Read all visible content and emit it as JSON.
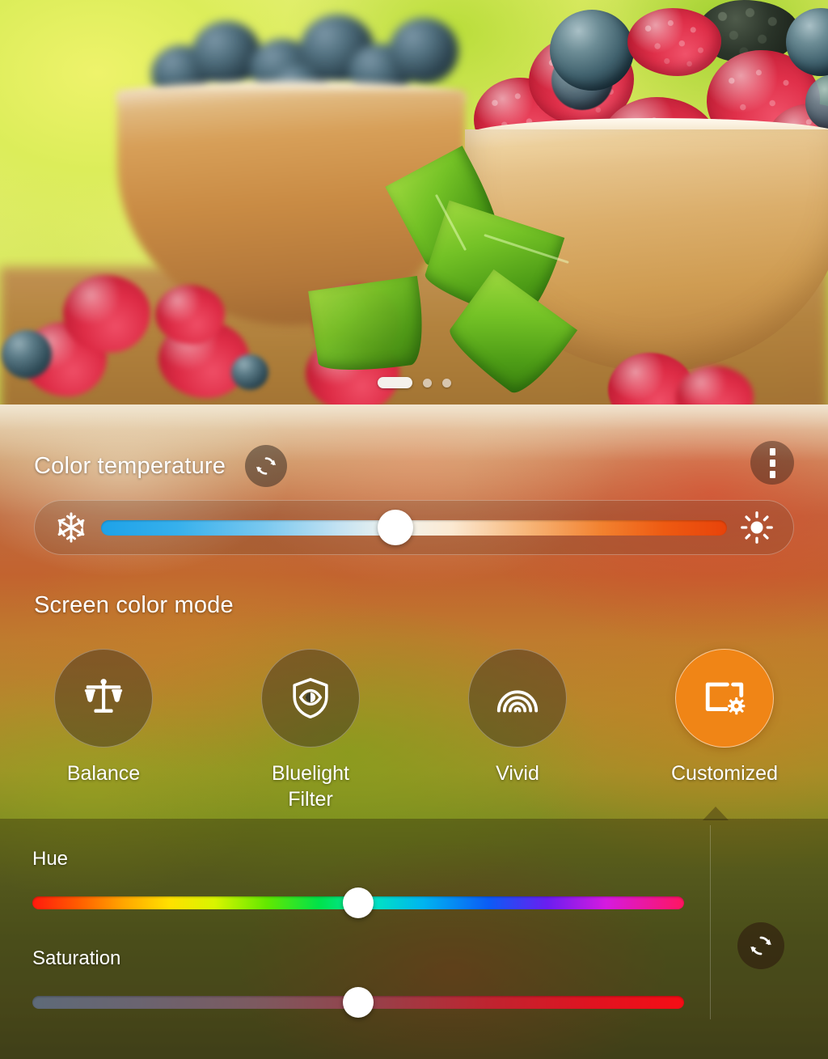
{
  "wallpaper": {
    "description": "Close-up photo of raspberries, blueberries and a blackberry in wooden bowls on a wooden table with mint leaves",
    "pager": {
      "total": 3,
      "active_index": 0
    }
  },
  "color_temperature": {
    "title": "Color temperature",
    "reset_icon": "refresh-icon",
    "overflow_icon": "more-vertical-icon",
    "cool_icon": "snowflake-icon",
    "warm_icon": "sun-icon",
    "value_percent": 47,
    "track_colors": {
      "cool": "#1ea2e8",
      "mid": "#f2f4ee",
      "warm": "#e8430a"
    }
  },
  "screen_color_mode": {
    "title": "Screen color mode",
    "selected": "Customized",
    "accent_color": "#f08516",
    "modes": [
      {
        "label": "Balance",
        "icon": "balance-scales-icon",
        "selected": false
      },
      {
        "label": "Bluelight\nFilter",
        "icon": "shield-eye-icon",
        "selected": false
      },
      {
        "label": "Vivid",
        "icon": "rainbow-arc-icon",
        "selected": false
      },
      {
        "label": "Customized",
        "icon": "screen-gear-icon",
        "selected": true
      }
    ]
  },
  "customized_panel": {
    "reset_icon": "refresh-icon",
    "sliders": [
      {
        "label": "Hue",
        "value_percent": 50
      },
      {
        "label": "Saturation",
        "value_percent": 50
      }
    ]
  }
}
